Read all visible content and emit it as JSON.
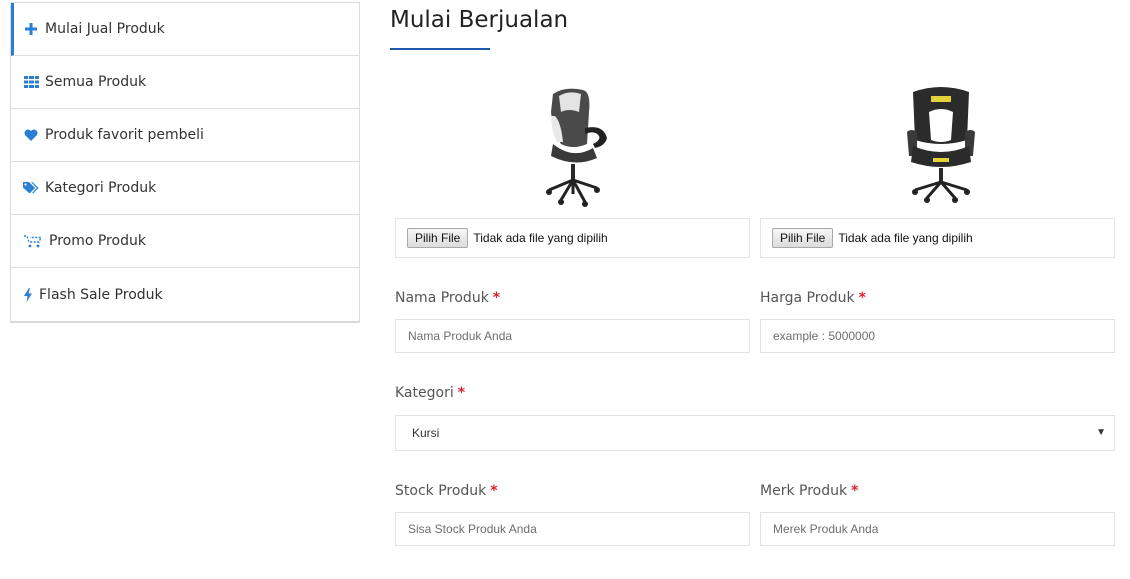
{
  "sidebar": {
    "items": [
      {
        "label": "Mulai Jual Produk",
        "icon": "plus-icon"
      },
      {
        "label": "Semua Produk",
        "icon": "grid-icon"
      },
      {
        "label": "Produk favorit pembeli",
        "icon": "heart-icon"
      },
      {
        "label": "Kategori Produk",
        "icon": "tags-icon"
      },
      {
        "label": "Promo Produk",
        "icon": "cart-icon"
      },
      {
        "label": "Flash Sale Produk",
        "icon": "bolt-icon"
      }
    ]
  },
  "colors": {
    "accent": "#2a7fd4",
    "title_underline": "#1e5aa8",
    "required": "#d9232d"
  },
  "main": {
    "title": "Mulai Berjualan",
    "uploads": [
      {
        "button": "Pilih File",
        "status": "Tidak ada file yang dipilih"
      },
      {
        "button": "Pilih File",
        "status": "Tidak ada file yang dipilih"
      }
    ],
    "form": {
      "nama": {
        "label": "Nama Produk",
        "required": "*",
        "placeholder": "Nama Produk Anda"
      },
      "harga": {
        "label": "Harga Produk",
        "required": "*",
        "placeholder": "example : 5000000"
      },
      "kategori": {
        "label": "Kategori",
        "required": "*",
        "value": "Kursi",
        "arrow": "▼"
      },
      "stock": {
        "label": "Stock Produk",
        "required": "*",
        "placeholder": "Sisa Stock Produk Anda"
      },
      "merk": {
        "label": "Merk Produk",
        "required": "*",
        "placeholder": "Merek Produk Anda"
      }
    }
  }
}
